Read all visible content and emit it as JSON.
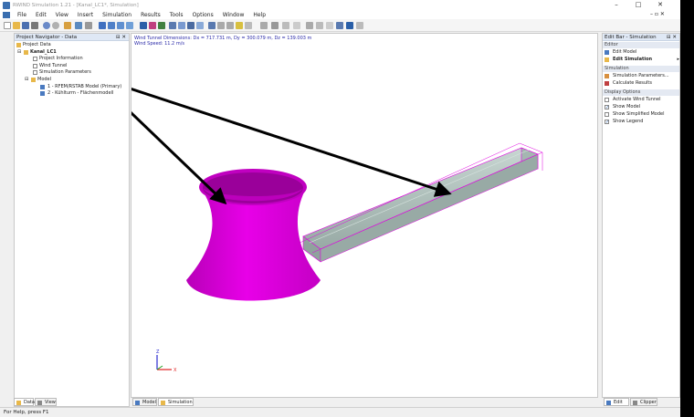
{
  "window": {
    "title": "RWIND Simulation 1.21 - [Kanal_LC1*, Simulation]",
    "minimize": "–",
    "maximize": "□",
    "close": "✕"
  },
  "menu": {
    "items": [
      "File",
      "Edit",
      "View",
      "Insert",
      "Simulation",
      "Results",
      "Tools",
      "Options",
      "Window",
      "Help"
    ],
    "mdi_controls": "– ▫ ✕"
  },
  "toolbar": {
    "icons": [
      "new-icon",
      "open-icon",
      "save-icon",
      "print-icon",
      "undo-icon",
      "redo-icon",
      "wizard-icon",
      "model-icon",
      "settings-icon",
      "view-iso-icon",
      "view-front-icon",
      "view-side-icon",
      "view-top-icon",
      "zoom-icon",
      "render-icon",
      "results-icon",
      "grid-icon",
      "select-icon",
      "help-icon"
    ]
  },
  "navigator": {
    "header": "Project Navigator - Data",
    "controls": "⊟ ✕",
    "tree": [
      {
        "label": "Project Data",
        "level": 0,
        "icon": "folder-icon"
      },
      {
        "label": "Kanal_LC1",
        "level": 1,
        "icon": "folder-icon",
        "bold": true
      },
      {
        "label": "Project Information",
        "level": 2,
        "icon": "document-icon"
      },
      {
        "label": "Wind Tunnel",
        "level": 2,
        "icon": "document-icon"
      },
      {
        "label": "Simulation Parameters",
        "level": 2,
        "icon": "document-icon"
      },
      {
        "label": "Model",
        "level": 2,
        "icon": "folder-icon"
      },
      {
        "label": "1 - RFEM/RSTAB Model (Primary)",
        "level": 3,
        "icon": "model-icon"
      },
      {
        "label": "2 - Kühlturm - Flächenmodell",
        "level": 3,
        "icon": "model-icon"
      }
    ],
    "tabs": [
      {
        "label": "Data"
      },
      {
        "label": "View"
      }
    ]
  },
  "viewport": {
    "info_line1": "Wind Tunnel Dimensions: Dx = 717.731 m, Dy = 300.079 m, Dz = 139.003 m",
    "info_line2": "Wind Speed: 11.2 m/s",
    "axis_x": "X",
    "axis_z": "Z",
    "tabs": [
      {
        "label": "Model"
      },
      {
        "label": "Simulation"
      }
    ]
  },
  "editbar": {
    "header": "Edit Bar - Simulation",
    "controls": "⊟ ✕",
    "sections": [
      {
        "title": "Editor",
        "items": [
          {
            "label": "Edit Model",
            "bold": false
          },
          {
            "label": "Edit Simulation",
            "bold": true,
            "arrow": "▸"
          }
        ]
      },
      {
        "title": "Simulation",
        "items": [
          {
            "label": "Simulation Parameters..."
          },
          {
            "label": "Calculate Results"
          }
        ]
      },
      {
        "title": "Display Options",
        "checks": [
          {
            "label": "Activate Wind Tunnel",
            "checked": false
          },
          {
            "label": "Show Model",
            "checked": true
          },
          {
            "label": "Show Simplified Model",
            "checked": false
          },
          {
            "label": "Show Legend",
            "checked": true
          }
        ]
      }
    ],
    "tabs": [
      {
        "label": "Edit Bar"
      },
      {
        "label": "Clipper"
      }
    ]
  },
  "status": {
    "text": "For Help, press F1"
  },
  "colors": {
    "tower": "#e000e0",
    "tunnel": "#b8c8c4",
    "accent": "#2a5fa8"
  }
}
